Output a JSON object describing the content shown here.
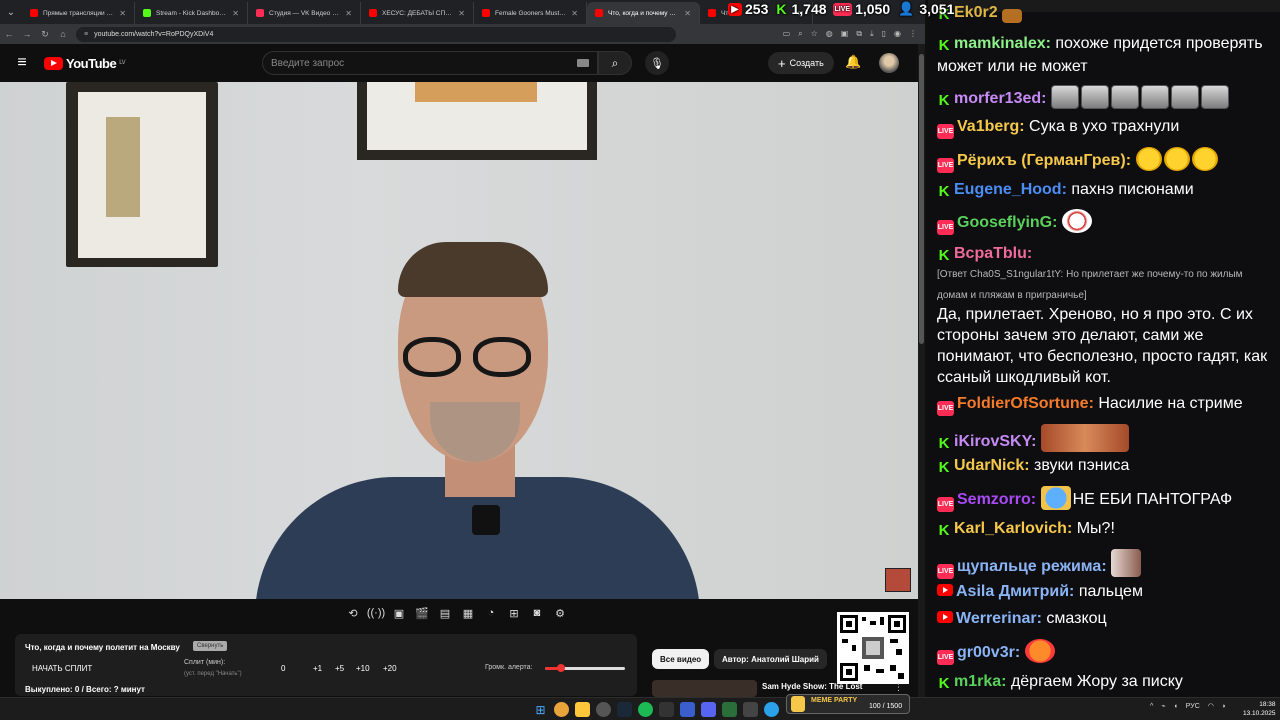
{
  "browser": {
    "tabs": [
      {
        "label": "Прямые трансляции - YouTube",
        "color": "#ff0000",
        "active": false
      },
      {
        "label": "Stream - Kick Dashboard",
        "color": "#53fc18",
        "active": false
      },
      {
        "label": "Студия — VK Видео Live",
        "color": "#ff2d55",
        "active": false
      },
      {
        "label": "ХЕСУС: ДЕБАТЫ СП6 1703 И",
        "color": "#ff0000",
        "active": false
      },
      {
        "label": "Female Gooners Must Be Str",
        "color": "#ff0000",
        "active": false
      },
      {
        "label": "Что, когда и почему пол",
        "color": "#ff0000",
        "active": true
      },
      {
        "label": "Что",
        "color": "#ff0000",
        "active": false
      }
    ],
    "url": "youtube.com/watch?v=RoPDQyXDiV4"
  },
  "overlay_counters": [
    {
      "platform": "youtube",
      "value": "253"
    },
    {
      "platform": "kick",
      "value": "1,748"
    },
    {
      "platform": "live",
      "value": "1,050"
    },
    {
      "platform": "total",
      "value": "3,051"
    }
  ],
  "youtube": {
    "logo": "YouTube",
    "logo_region": "LV",
    "search_placeholder": "Введите запрос",
    "create_label": "Создать"
  },
  "split_panel": {
    "title": "Что, когда и почему полетит на Москву",
    "minimize_label": "Свернуть",
    "start_label": "НАЧАТЬ СПЛИТ",
    "split_label": "Сплит (мин):",
    "split_hint": "(уст. перед \"Начать\")",
    "zero": "0",
    "increments": [
      "+1",
      "+5",
      "+10",
      "+20"
    ],
    "volume_label": "Громк. алерта:",
    "alert_volume": 0.2,
    "bought": "Выкуплено: 0 / Всего: ? минут"
  },
  "filters": {
    "all_videos": "Все видео",
    "author": "Автор: Анатолий Шарий"
  },
  "reco": {
    "title": "Sam Hyde Show: The Lost"
  },
  "chat": [
    {
      "platform": "kick",
      "user": "mamkinalex",
      "color": "#8ef08a",
      "text": "похоже придется проверять может или не может"
    },
    {
      "platform": "kick",
      "user": "morfer13ed",
      "color": "#c68af5",
      "text": "",
      "emote": "wolf",
      "emote_count": 6
    },
    {
      "platform": "live",
      "user": "Va1berg",
      "color": "#f5c84a",
      "text": "Сука в ухо трахнули"
    },
    {
      "platform": "live",
      "user": "Рёрихъ (ГерманГрев)",
      "color": "#f5c84a",
      "text": "",
      "emote": "grin",
      "emote_count": 3
    },
    {
      "platform": "kick",
      "user": "Eugene_Hood",
      "color": "#4a8ef5",
      "text": "пахнэ писюнами"
    },
    {
      "platform": "live",
      "user": "GooseflyinG",
      "color": "#5ad15a",
      "text": "",
      "emote": "clown",
      "emote_count": 1
    },
    {
      "platform": "kick",
      "user": "BcpaTblu",
      "color": "#f06a9a",
      "text": ""
    },
    {
      "platform": "live",
      "user": "FoldierOfSortune",
      "color": "#f57a2a",
      "text": "Насилие на стриме"
    },
    {
      "platform": "kick",
      "user": "iKirovSKY",
      "color": "#c68af5",
      "text": "",
      "emote": "face",
      "emote_count": 1
    },
    {
      "platform": "kick",
      "user": "UdarNick",
      "color": "#f5c84a",
      "text": "звуки пэниса"
    },
    {
      "platform": "live",
      "user": "Semzorro",
      "color": "#a84af5",
      "text": "НЕ ЕБИ ПАНТОГРАФ",
      "emote": "laugh",
      "emote_count": 1
    },
    {
      "platform": "kick",
      "user": "Karl_Karlovich",
      "color": "#f5c84a",
      "text": "Мы?!"
    },
    {
      "platform": "live",
      "user": "щупальце режима",
      "color": "#8ab4f5",
      "text": "",
      "emote": "pic",
      "emote_count": 1
    },
    {
      "platform": "yt",
      "user": "Asila Дмитрий",
      "color": "#8ab4f5",
      "text": "пальцем"
    },
    {
      "platform": "yt",
      "user": "Werrerinar",
      "color": "#8ab4f5",
      "text": "смазкоц"
    },
    {
      "platform": "live",
      "user": "gr00v3r",
      "color": "#8ab4f5",
      "text": "",
      "emote": "love",
      "emote_count": 1
    },
    {
      "platform": "kick",
      "user": "m1rka",
      "color": "#5ad15a",
      "text": "дёргаем Жору за писку"
    }
  ],
  "chat_reply": "[Ответ Cha0S_S1ngular1tY: Но прилетает же почему-то по жилым домам и пляжам в приграничье]",
  "chat_long_text": "Да, прилетает. Хреново, но я про это. С их стороны зачем это делают, сами же понимают, что бесполезно, просто гадят, как ссаный шкодливый кот.",
  "chat_top_partial": "Ek0r2",
  "taskbar": {
    "lang": "РУС",
    "time": "18:38",
    "date": "13.10.2025",
    "banner": "MEME PARTY",
    "banner_progress": "100 / 1500"
  }
}
